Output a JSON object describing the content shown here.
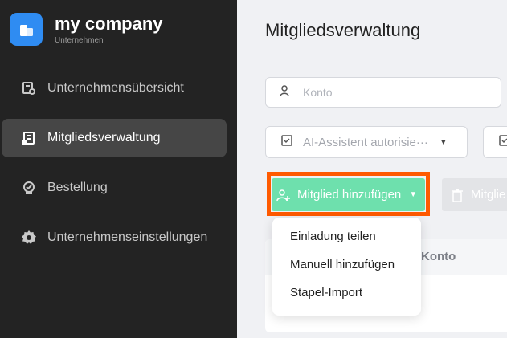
{
  "brand": {
    "name": "my company",
    "subtitle": "Unternehmen"
  },
  "nav": [
    {
      "label": "Unternehmensübersicht",
      "icon": "overview-icon",
      "active": false
    },
    {
      "label": "Mitgliedsverwaltung",
      "icon": "members-icon",
      "active": true
    },
    {
      "label": "Bestellung",
      "icon": "order-icon",
      "active": false
    },
    {
      "label": "Unternehmenseinstellungen",
      "icon": "gear-icon",
      "active": false
    }
  ],
  "main": {
    "title": "Mitgliedsverwaltung",
    "search": {
      "placeholder": "Konto"
    },
    "filter1": {
      "value": "AI-Assistent autorisie···"
    },
    "add_button": "Mitglied hinzufügen",
    "delete_button": "Mitglie",
    "table": {
      "columns": [
        "Konto"
      ]
    }
  },
  "dropdown": {
    "items": [
      "Einladung teilen",
      "Manuell hinzufügen",
      "Stapel-Import"
    ]
  },
  "colors": {
    "sidebar": "#232323",
    "accent_green": "#6ee0ad",
    "highlight": "#ff5a00",
    "logo": "#2f8cf2"
  }
}
